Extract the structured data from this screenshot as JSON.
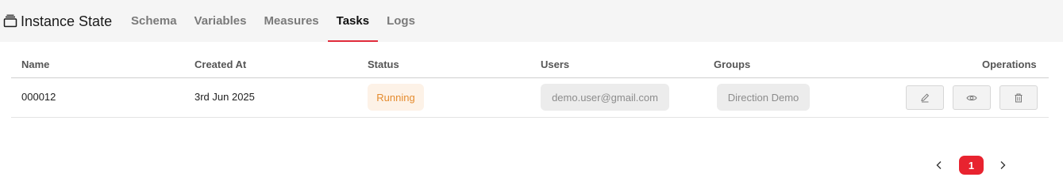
{
  "header": {
    "title": "Instance State",
    "title_icon": "instance-icon",
    "tabs": [
      {
        "label": "Schema",
        "active": false
      },
      {
        "label": "Variables",
        "active": false
      },
      {
        "label": "Measures",
        "active": false
      },
      {
        "label": "Tasks",
        "active": true
      },
      {
        "label": "Logs",
        "active": false
      }
    ],
    "active_tab_accent": "#e02b3b"
  },
  "table": {
    "columns": [
      "Name",
      "Created At",
      "Status",
      "Users",
      "Groups",
      "Operations"
    ],
    "rows": [
      {
        "name": "000012",
        "created_at": "3rd Jun 2025",
        "status": "Running",
        "users": "demo.user@gmail.com",
        "groups": "Direction Demo",
        "operations": [
          "edit-icon",
          "view-icon",
          "delete-icon"
        ]
      }
    ],
    "status_colors": {
      "Running": {
        "text": "#e58c2f",
        "background": "#fdf2e7"
      }
    }
  },
  "pagination": {
    "current_page": "1",
    "prev_icon": "chevron-left-icon",
    "next_icon": "chevron-right-icon",
    "accent": "#e8232f"
  }
}
